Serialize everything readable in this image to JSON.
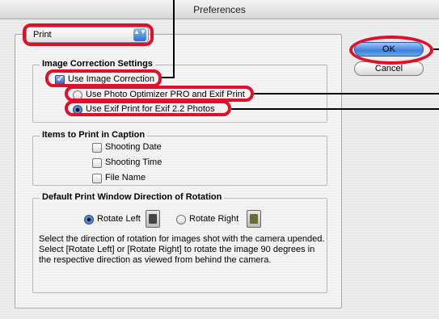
{
  "window": {
    "title": "Preferences"
  },
  "popup": {
    "value": "Print",
    "arrows": "▲▼"
  },
  "image_correction": {
    "title": "Image Correction Settings",
    "use_label": "Use Image Correction",
    "use_checked": true,
    "options": [
      {
        "label": "Use Photo Optimizer PRO and Exif Print",
        "selected": false
      },
      {
        "label": "Use Exif Print for Exif 2.2 Photos",
        "selected": true
      }
    ]
  },
  "caption": {
    "title": "Items to Print in Caption",
    "items": [
      {
        "label": "Shooting Date",
        "checked": false
      },
      {
        "label": "Shooting Time",
        "checked": false
      },
      {
        "label": "File Name",
        "checked": false
      }
    ]
  },
  "rotation": {
    "title": "Default Print Window Direction of Rotation",
    "left_label": "Rotate Left",
    "right_label": "Rotate Right",
    "selected": "left",
    "desc_line1": "Select the direction of rotation for images shot with the camera upended.",
    "desc_line2": "Select [Rotate Left] or [Rotate Right] to rotate the image 90 degrees in the respective direction as viewed from behind the camera."
  },
  "buttons": {
    "ok": "OK",
    "cancel": "Cancel"
  },
  "colors": {
    "highlight": "#e0102a",
    "accent": "#3f7fdb"
  },
  "icons": {
    "popup": "up-down-arrows-icon",
    "rotate_left": "rotate-left-camera-icon",
    "rotate_right": "rotate-right-camera-icon"
  }
}
